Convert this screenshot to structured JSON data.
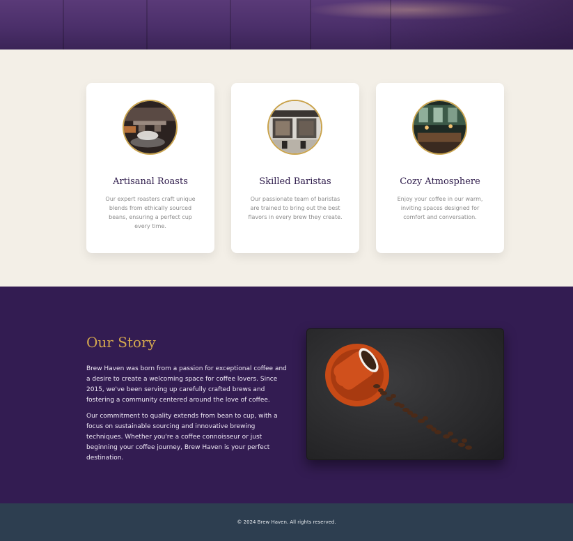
{
  "features": [
    {
      "title": "Artisanal Roasts",
      "text": "Our expert roasters craft unique blends from ethically sourced beans, ensuring a perfect cup every time.",
      "image": "espresso-machine-photo"
    },
    {
      "title": "Skilled Baristas",
      "text": "Our passionate team of baristas are trained to bring out the best flavors in every brew they create.",
      "image": "cafe-storefront-photo"
    },
    {
      "title": "Cozy Atmosphere",
      "text": "Enjoy your coffee in our warm, inviting spaces designed for comfort and conversation.",
      "image": "cafe-interior-photo"
    }
  ],
  "story": {
    "heading": "Our Story",
    "paragraph1": "Brew Haven was born from a passion for exceptional coffee and a desire to create a welcoming space for coffee lovers. Since 2015, we've been serving up carefully crafted brews and fostering a community centered around the love of coffee.",
    "paragraph2": "Our commitment to quality extends from bean to cup, with a focus on sustainable sourcing and innovative brewing techniques. Whether you're a coffee connoisseur or just beginning your coffee journey, Brew Haven is your perfect destination.",
    "image": "coffee-cup-with-spilled-beans-photo"
  },
  "footer": {
    "copyright": "© 2024 Brew Haven. All rights reserved."
  },
  "colors": {
    "accent_gold": "#c9a24a",
    "story_bg": "#331c52",
    "footer_bg": "#2d3e50",
    "features_bg": "#f3efe7"
  }
}
